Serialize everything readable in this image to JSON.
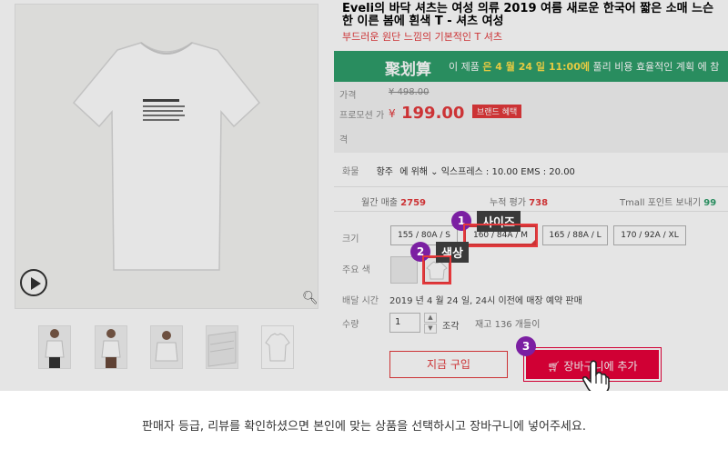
{
  "product": {
    "title": "Eveli의 바닥 셔츠는 여성 의류 2019 여름 새로운 한국어 짧은 소매 느슨한 이른 봄에 흰색 T - 셔츠 여성",
    "subtitle": "부드러운 원단 느낌의 기본적인 T 셔츠",
    "promo": {
      "logo": "聚划算",
      "text_before": "이 제품 ",
      "date": "은 4 월 24 일 11:00에",
      "text_after": " 풀리 비용 효율적인 계획 에 참"
    },
    "price": {
      "price_label": "가격",
      "original": "¥ 498.00",
      "promo_label": "프로모션 가",
      "promo_label_cont": "격",
      "currency": "¥",
      "promo_price": "199.00",
      "badge": "브랜드 혜택"
    },
    "shipping": {
      "label": "화물",
      "from": "항주",
      "to": "에 위해",
      "method": "익스프레스 : 10.00 EMS : 20.00"
    },
    "stats": {
      "monthly_sales_label": "월간 매출",
      "monthly_sales": "2759",
      "reviews_label": "누적 평가",
      "reviews": "738",
      "points_label": "Tmall 포인트 보내기",
      "points": "99"
    },
    "size": {
      "label": "크기",
      "options": [
        "155 / 80A / S",
        "160 / 84A / M",
        "165 / 88A / L",
        "170 / 92A / XL"
      ],
      "selected_index": 1
    },
    "color": {
      "label": "주요 색"
    },
    "delivery": {
      "label": "배달 시간",
      "text": "2019 년 4 월 24 일, 24시 이전에 매장 예약 판매"
    },
    "quantity": {
      "label": "수량",
      "value": "1",
      "unit": "조각",
      "stock": "재고 136 개들이"
    },
    "buttons": {
      "buy_now": "지금 구입",
      "add_to_cart": "장바구니에 추가"
    }
  },
  "annotations": {
    "step1": {
      "number": "1",
      "label": "사이즈"
    },
    "step2": {
      "number": "2",
      "label": "색상"
    },
    "step3": {
      "number": "3"
    }
  },
  "instruction": "판매자 등급, 리뷰를 확인하셨으면 본인에 맞는 상품을 선택하시고 장바구니에 넣어주세요.",
  "colors": {
    "accent_red": "#e4393c",
    "cart_red": "#e8003a",
    "promo_green": "#2e9d6a",
    "annotation_purple": "#7b1fa2"
  },
  "icons": {
    "play": "play-icon",
    "zoom": "magnifier-icon",
    "cart": "cart-icon",
    "cursor": "hand-pointer-icon"
  }
}
